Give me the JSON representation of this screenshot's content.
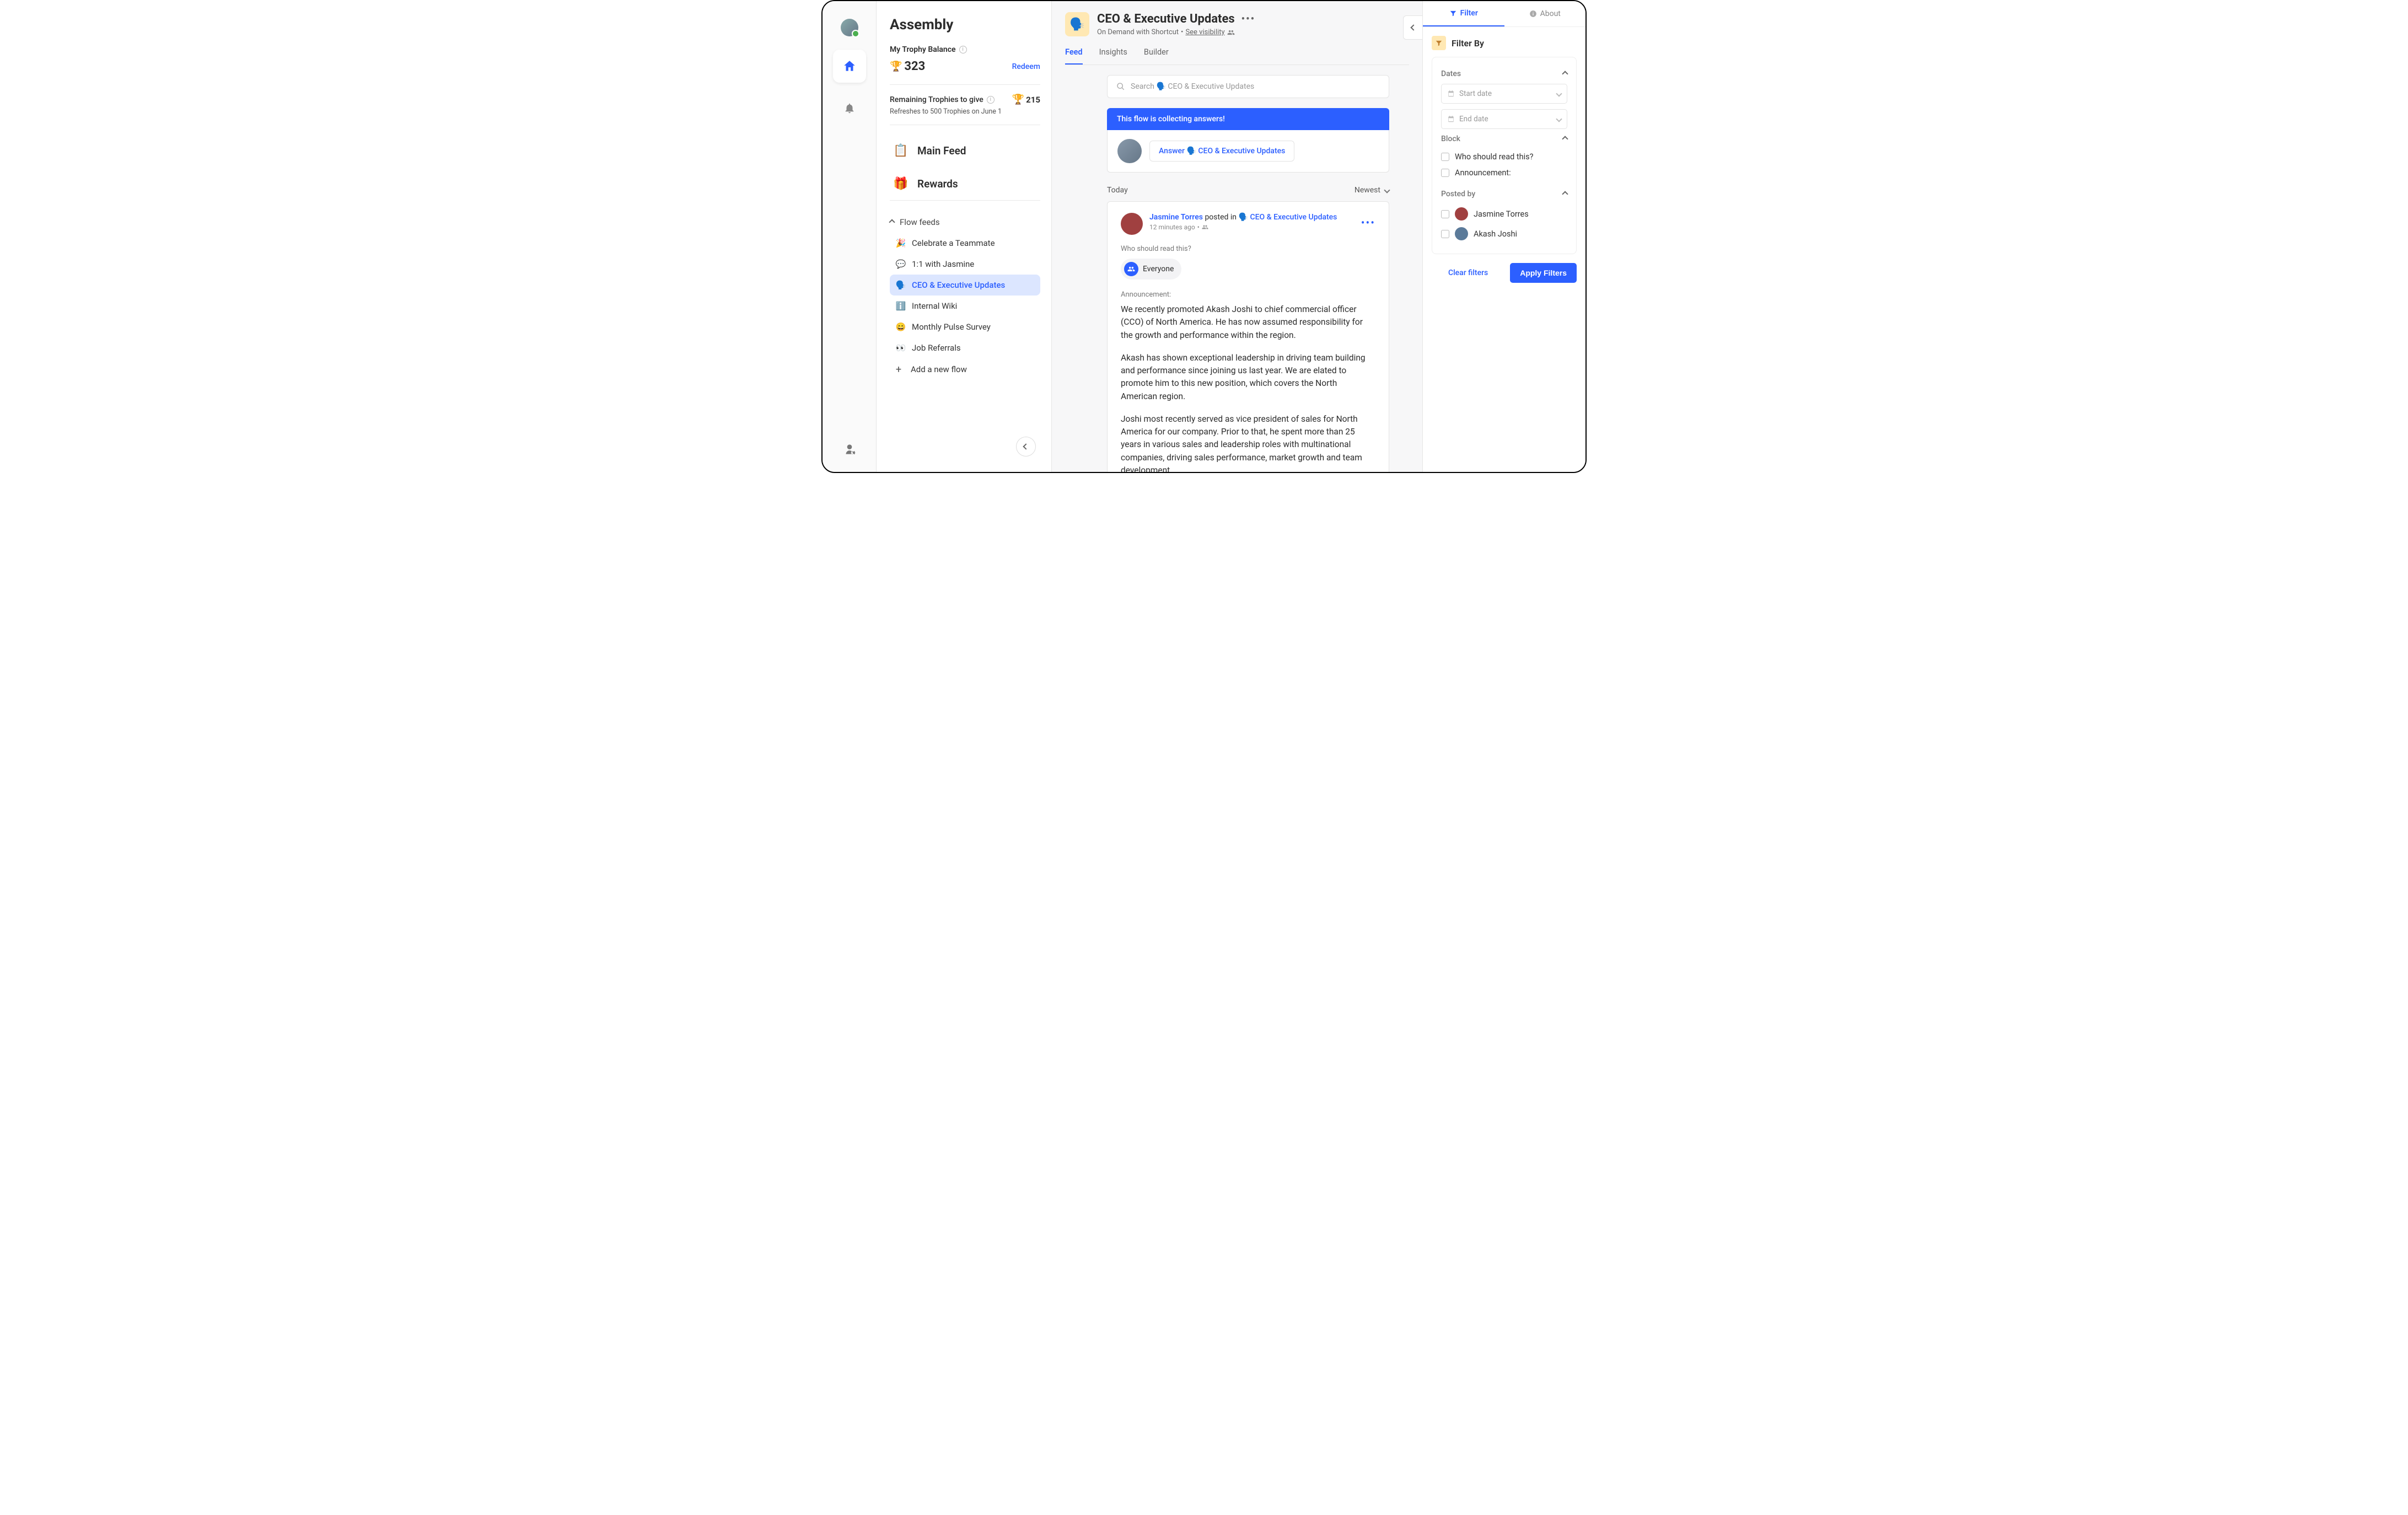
{
  "brand": "Assembly",
  "balance": {
    "label": "My Trophy Balance",
    "value": "323",
    "redeem": "Redeem",
    "remaining_label": "Remaining Trophies to give",
    "remaining_value": "215",
    "refresh_note": "Refreshes to 500 Trophies on June 1"
  },
  "nav": {
    "main_feed": "Main Feed",
    "rewards": "Rewards"
  },
  "flow_section": "Flow feeds",
  "flows": [
    {
      "emoji": "🎉",
      "label": "Celebrate a Teammate"
    },
    {
      "emoji": "💬",
      "label": "1:1 with Jasmine"
    },
    {
      "emoji": "🗣️",
      "label": "CEO & Executive Updates"
    },
    {
      "emoji": "ℹ️",
      "label": "Internal Wiki"
    },
    {
      "emoji": "😄",
      "label": "Monthly Pulse Survey"
    },
    {
      "emoji": "👀",
      "label": "Job Referrals"
    }
  ],
  "add_flow": "Add a new flow",
  "header": {
    "emoji": "🗣️",
    "title": "CEO & Executive Updates",
    "sub_prefix": "On Demand with Shortcut",
    "see_visibility": "See visibility"
  },
  "tabs": {
    "feed": "Feed",
    "insights": "Insights",
    "builder": "Builder"
  },
  "search_placeholder": "Search 🗣️ CEO & Executive Updates",
  "banner": "This flow is collecting answers!",
  "answer_prompt": "Answer 🗣️ CEO & Executive Updates",
  "feed_day": "Today",
  "sort": "Newest",
  "post": {
    "author": "Jasmine Torres",
    "verb": "posted in",
    "flow_emoji": "🗣️",
    "flow": "CEO & Executive Updates",
    "time": "12 minutes ago",
    "q1": "Who should read this?",
    "audience": "Everyone",
    "ann_label": "Announcement:",
    "p1": "We recently promoted Akash Joshi to chief commercial officer (CCO) of North America. He has now assumed responsibility for the growth and performance within the region.",
    "p2": "Akash has shown exceptional leadership in driving team building and performance since joining us last year. We are elated to promote him to this new position, which covers the North American region.",
    "p3": "Joshi most recently served as vice president of sales for North America for our company. Prior to that, he spent more than 25 years in various sales and leadership roles with multinational companies, driving sales performance, market growth and team development."
  },
  "right": {
    "filter_tab": "Filter",
    "about_tab": "About",
    "filter_by": "Filter By",
    "dates": "Dates",
    "start_date": "Start date",
    "end_date": "End date",
    "block": "Block",
    "block_q1": "Who should read this?",
    "block_q2": "Announcement:",
    "posted_by": "Posted by",
    "person1": "Jasmine Torres",
    "person2": "Akash Joshi",
    "clear": "Clear filters",
    "apply": "Apply Filters"
  }
}
